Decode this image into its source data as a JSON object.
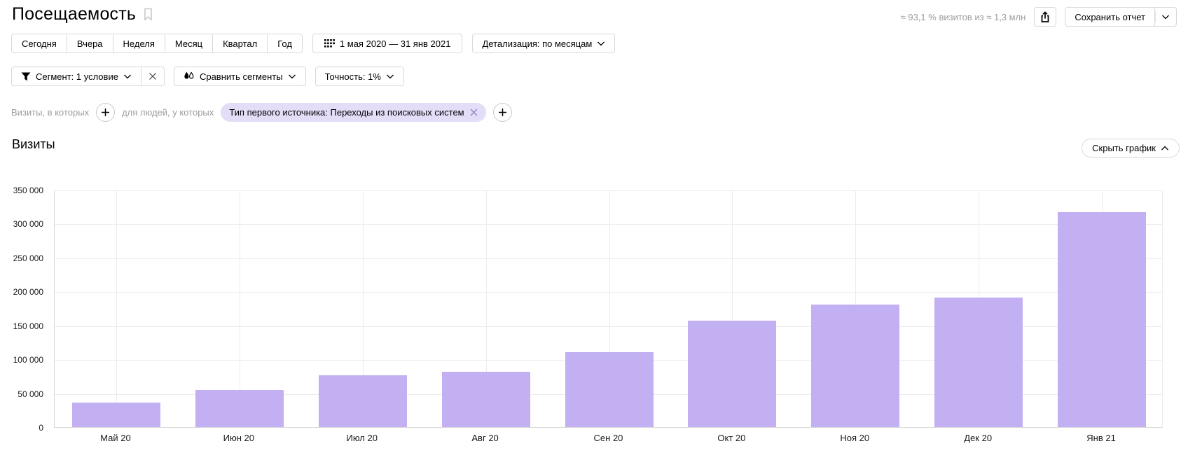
{
  "header": {
    "title": "Посещаемость",
    "sample_info": "≈ 93,1 % визитов из ≈ 1,3 млн",
    "save_report_label": "Сохранить отчет"
  },
  "toolbar": {
    "period_buttons": [
      "Сегодня",
      "Вчера",
      "Неделя",
      "Месяц",
      "Квартал",
      "Год"
    ],
    "date_range": "1 мая 2020 — 31 янв 2021",
    "detail_label": "Детализация: по месяцам"
  },
  "segment_bar": {
    "segment_label": "Сегмент: 1 условие",
    "compare_label": "Сравнить сегменты",
    "accuracy_label": "Точность: 1%"
  },
  "filter_bar": {
    "visits_label": "Визиты, в которых",
    "people_label": "для людей, у которых",
    "chip_label": "Тип первого источника: Переходы из поисковых систем"
  },
  "chart_section": {
    "title": "Визиты",
    "hide_chart_label": "Скрыть график"
  },
  "chart_data": {
    "type": "bar",
    "title": "Визиты",
    "categories": [
      "Май 20",
      "Июн 20",
      "Июл 20",
      "Авг 20",
      "Сен 20",
      "Окт 20",
      "Ноя 20",
      "Дек 20",
      "Янв 21"
    ],
    "values": [
      36000,
      55000,
      76500,
      81500,
      110000,
      157000,
      181000,
      191000,
      317000
    ],
    "ylim": [
      0,
      350000
    ],
    "ytick_step": 50000,
    "xlabel": "",
    "ylabel": "",
    "grid": true,
    "legend": "none",
    "bar_color": "#c2b0f2"
  },
  "icons": {
    "bookmark": "bookmark-outline",
    "share": "export-arrow-up",
    "calendar": "calendar-dots",
    "segment": "filter-funnel",
    "compare": "two-drops",
    "chevron_down": "chevron-down",
    "chevron_up": "chevron-up",
    "plus": "plus",
    "close": "x-cross"
  },
  "colors": {
    "bar": "#c2b0f2",
    "chip_bg": "#e3ddf8",
    "muted_text": "#9c9c9c",
    "border": "#d9d9d9",
    "grid": "#ececec"
  }
}
